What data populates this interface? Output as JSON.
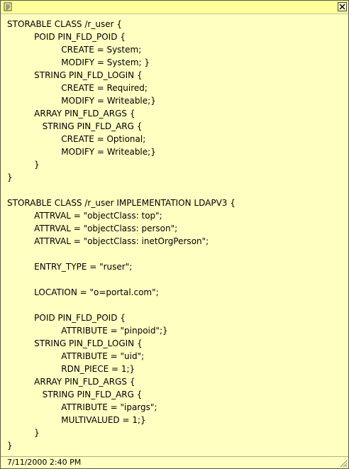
{
  "window": {
    "icon": "note-icon",
    "close_icon": "close-icon"
  },
  "lines": [
    "STORABLE CLASS /r_user {",
    "          POID PIN_FLD_POID {",
    "                    CREATE = System;",
    "                    MODIFY = System; }",
    "          STRING PIN_FLD_LOGIN {",
    "                    CREATE = Required;",
    "                    MODIFY = Writeable;}",
    "          ARRAY PIN_FLD_ARGS {",
    "             STRING PIN_FLD_ARG {",
    "                    CREATE = Optional;",
    "                    MODIFY = Writeable;}",
    "          }",
    "}",
    "",
    "STORABLE CLASS /r_user IMPLEMENTATION LDAPV3 {",
    "          ATTRVAL = \"objectClass: top\";",
    "          ATTRVAL = \"objectClass: person\";",
    "          ATTRVAL = \"objectClass: inetOrgPerson\";",
    "",
    "          ENTRY_TYPE = \"ruser\";",
    "",
    "          LOCATION = \"o=portal.com\";",
    "",
    "          POID PIN_FLD_POID {",
    "                    ATTRIBUTE = \"pinpoid\";}",
    "          STRING PIN_FLD_LOGIN {",
    "                    ATTRIBUTE = \"uid\";",
    "                    RDN_PIECE = 1;}",
    "          ARRAY PIN_FLD_ARGS {",
    "             STRING PIN_FLD_ARG {",
    "                    ATTRIBUTE = \"ipargs\";",
    "                    MULTIVALUED = 1;}",
    "          }",
    "}"
  ],
  "footer": {
    "timestamp": "7/11/2000 2:40 PM"
  }
}
